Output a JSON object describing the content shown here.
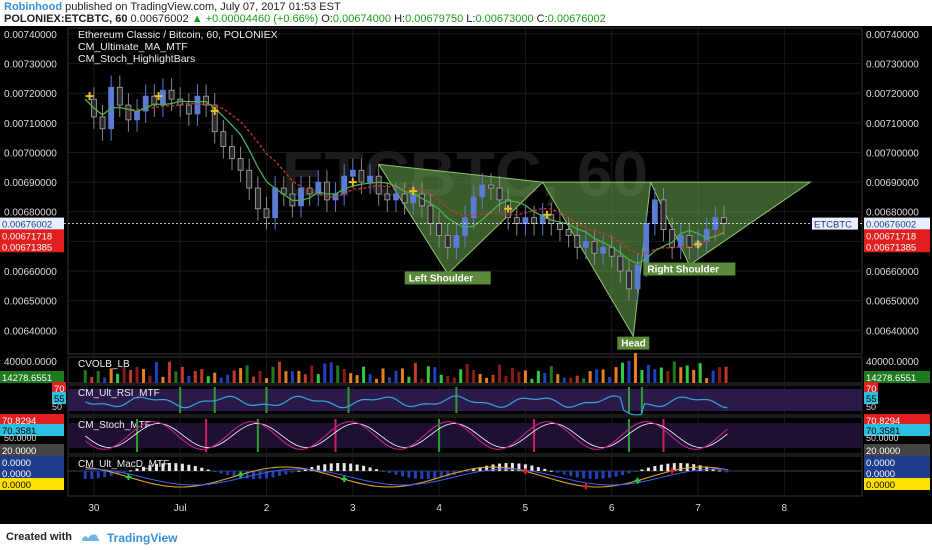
{
  "header": {
    "author": "Robinhood",
    "published": "published on TradingView.com, July 07, 2017 01:53 EST",
    "symbol": "POLONIEX:ETCBTC, 60",
    "last": "0.00676002",
    "change": "+0.00004460 (+0.66%)",
    "o_label": "O:",
    "o_val": "0.00674000",
    "h_label": "H:",
    "h_val": "0.00679750",
    "l_label": "L:",
    "l_val": "0.00673000",
    "c_label": "C:",
    "c_val": "0.00676002"
  },
  "footer": {
    "created": "Created with",
    "brand": "TradingView"
  },
  "colors": {
    "background": "#000000",
    "up": "#5b7bd5",
    "down": "#2a2a2a",
    "pattern_fill": "#6aa84f",
    "ma_red": "#d03030",
    "ma_green": "#4caf50",
    "label_bg": "#5a8a3a",
    "price_tag_current": "#1e3c8c",
    "price_tag_red": "#e02020",
    "cross": "#e8c020",
    "rsi_line": "#3aa0e0",
    "stoch_k": "#c02090",
    "stoch_d": "#ffffff",
    "macd_line": "#e0a020",
    "signal_line": "#4060ff"
  },
  "chart_data": [
    {
      "type": "candlestick",
      "title": "Ethereum Classic / Bitcoin, 60, POLONIEX",
      "indicators": [
        "CM_Ultimate_MA_MTF",
        "CM_Stoch_HighlightBars"
      ],
      "watermark": "ETCBTC, 60",
      "x_ticks": [
        "30",
        "Jul",
        "2",
        "3",
        "4",
        "5",
        "6",
        "7",
        "8"
      ],
      "y_ticks": [
        "0.00740000",
        "0.00730000",
        "0.00720000",
        "0.00710000",
        "0.00700000",
        "0.00690000",
        "0.00680000",
        "0.00670000",
        "0.00660000",
        "0.00650000",
        "0.00640000"
      ],
      "ylim": [
        0.00632,
        0.00742
      ],
      "xlim": [
        -0.7,
        8.5
      ],
      "close_series": [
        [
          -0.5,
          0.00718
        ],
        [
          -0.4,
          0.00712
        ],
        [
          -0.3,
          0.00708
        ],
        [
          -0.2,
          0.00722
        ],
        [
          -0.1,
          0.00716
        ],
        [
          0.0,
          0.00711
        ],
        [
          0.1,
          0.00714
        ],
        [
          0.2,
          0.00719
        ],
        [
          0.3,
          0.00716
        ],
        [
          0.4,
          0.00721
        ],
        [
          0.5,
          0.00718
        ],
        [
          0.6,
          0.00716
        ],
        [
          0.7,
          0.00713
        ],
        [
          0.8,
          0.00719
        ],
        [
          0.9,
          0.00716
        ],
        [
          1.0,
          0.00707
        ],
        [
          1.1,
          0.00702
        ],
        [
          1.2,
          0.00698
        ],
        [
          1.3,
          0.00694
        ],
        [
          1.4,
          0.00688
        ],
        [
          1.5,
          0.00681
        ],
        [
          1.6,
          0.00678
        ],
        [
          1.7,
          0.00688
        ],
        [
          1.8,
          0.00686
        ],
        [
          1.9,
          0.00682
        ],
        [
          2.0,
          0.00688
        ],
        [
          2.1,
          0.00686
        ],
        [
          2.2,
          0.0069
        ],
        [
          2.3,
          0.00684
        ],
        [
          2.4,
          0.00686
        ],
        [
          2.5,
          0.00692
        ],
        [
          2.6,
          0.00694
        ],
        [
          2.7,
          0.0069
        ],
        [
          2.8,
          0.00692
        ],
        [
          2.9,
          0.00686
        ],
        [
          3.0,
          0.00684
        ],
        [
          3.1,
          0.00686
        ],
        [
          3.2,
          0.00683
        ],
        [
          3.3,
          0.00686
        ],
        [
          3.4,
          0.00682
        ],
        [
          3.5,
          0.00676
        ],
        [
          3.6,
          0.00672
        ],
        [
          3.7,
          0.00668
        ],
        [
          3.8,
          0.00672
        ],
        [
          3.9,
          0.00678
        ],
        [
          4.0,
          0.00685
        ],
        [
          4.1,
          0.00689
        ],
        [
          4.2,
          0.00688
        ],
        [
          4.3,
          0.00684
        ],
        [
          4.4,
          0.00678
        ],
        [
          4.5,
          0.00676
        ],
        [
          4.6,
          0.00678
        ],
        [
          4.7,
          0.00676
        ],
        [
          4.8,
          0.00679
        ],
        [
          4.9,
          0.00676
        ],
        [
          5.0,
          0.00674
        ],
        [
          5.1,
          0.00672
        ],
        [
          5.2,
          0.00668
        ],
        [
          5.3,
          0.0067
        ],
        [
          5.4,
          0.00666
        ],
        [
          5.5,
          0.00668
        ],
        [
          5.6,
          0.00665
        ],
        [
          5.7,
          0.0066
        ],
        [
          5.8,
          0.00654
        ],
        [
          5.9,
          0.00662
        ],
        [
          6.0,
          0.00676
        ],
        [
          6.1,
          0.00684
        ],
        [
          6.2,
          0.00674
        ],
        [
          6.3,
          0.00668
        ],
        [
          6.4,
          0.00672
        ],
        [
          6.5,
          0.00668
        ],
        [
          6.6,
          0.0067
        ],
        [
          6.7,
          0.00674
        ],
        [
          6.8,
          0.00678
        ],
        [
          6.9,
          0.00676
        ]
      ],
      "price_tags": [
        {
          "label": "0.00676002",
          "value": 0.00676002,
          "kind": "current"
        },
        {
          "label": "0.00671718",
          "value": 0.00671718,
          "kind": "ma"
        },
        {
          "label": "0.00671385",
          "value": 0.00671385,
          "kind": "ma"
        }
      ],
      "symbol_tag": "ETCBTC",
      "pattern": {
        "name": "inverse head and shoulders",
        "labels": [
          {
            "text": "Left Shoulder",
            "x": 3.7,
            "y": 0.006575
          },
          {
            "text": "Head",
            "x": 5.85,
            "y": 0.006355
          },
          {
            "text": "Right Shoulder",
            "x": 6.5,
            "y": 0.006605
          }
        ],
        "triangles": [
          [
            [
              2.9,
              0.00696
            ],
            [
              3.7,
              0.00659
            ],
            [
              4.8,
              0.0069
            ]
          ],
          [
            [
              4.8,
              0.0069
            ],
            [
              5.85,
              0.00638
            ],
            [
              6.05,
              0.0069
            ]
          ],
          [
            [
              6.05,
              0.0069
            ],
            [
              6.5,
              0.00662
            ],
            [
              7.9,
              0.0069
            ]
          ]
        ]
      },
      "crosses": [
        [
          -0.45,
          0.00719
        ],
        [
          0.35,
          0.00719
        ],
        [
          1.0,
          0.00714
        ],
        [
          2.6,
          0.0069
        ],
        [
          3.3,
          0.00687
        ],
        [
          4.4,
          0.00681
        ],
        [
          4.85,
          0.00679
        ],
        [
          6.6,
          0.00669
        ]
      ]
    },
    {
      "type": "bar",
      "title": "CVOLB_LB",
      "y_ticks": [
        "40000.0000"
      ],
      "value_tag": "14278.6551",
      "value": 14278.6551,
      "ylim": [
        0,
        42000
      ]
    },
    {
      "type": "line",
      "title": "CM_Ult_RSI_MTF",
      "y_ticks": [
        "70",
        "50"
      ],
      "value_tag": "55",
      "value": 55,
      "ylim": [
        30,
        80
      ]
    },
    {
      "type": "line",
      "title": "CM_Stoch_MTF",
      "y_ticks": [
        "50.0000",
        "20.0000"
      ],
      "value_tags": [
        "70.8294",
        "70.3581"
      ],
      "values": [
        70.8294,
        70.3581
      ],
      "ylim": [
        10,
        90
      ]
    },
    {
      "type": "line",
      "title": "CM_Ult_MacD_MTF",
      "value_tags": [
        "0.0000",
        "0.0000",
        "0.0000"
      ],
      "values": [
        0,
        0,
        0
      ]
    }
  ]
}
